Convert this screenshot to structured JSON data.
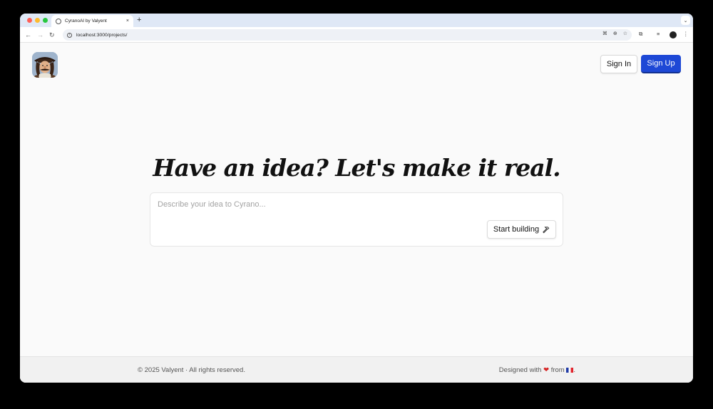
{
  "browser": {
    "tab_title": "CyranoAI by Valyent",
    "tab_close": "×",
    "new_tab": "+",
    "tab_menu": "⌄",
    "url": "localhost:3000/projects/"
  },
  "header": {
    "signin_label": "Sign In",
    "signup_label": "Sign Up"
  },
  "hero": {
    "title": "Have an idea? Let's make it real."
  },
  "prompt": {
    "placeholder": "Describe your idea to Cyrano...",
    "value": "",
    "start_label": "Start building"
  },
  "footer": {
    "copyright": "© 2025 Valyent · All rights reserved.",
    "designed_prefix": "Designed with",
    "designed_from": "from",
    "designed_suffix": "."
  },
  "colors": {
    "primary": "#1d48d6",
    "background": "#fafafa",
    "footer_bg": "#f1f1f1"
  }
}
